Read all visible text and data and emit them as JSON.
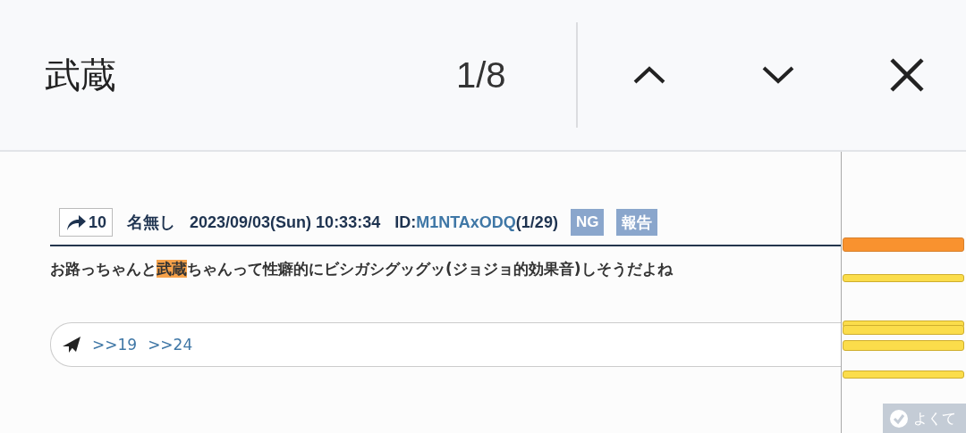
{
  "find_bar": {
    "query": "武蔵",
    "count": "1/8"
  },
  "post": {
    "share_count": "10",
    "name": "名無し",
    "date": "2023/09/03(Sun) 10:33:34",
    "id_label": "ID:",
    "id": "M1NTAxODQ",
    "id_count": "(1/29)",
    "buttons": [
      "NG",
      "報告"
    ],
    "body": [
      {
        "text": "お路っちゃんと",
        "highlighted": false
      },
      {
        "text": "武蔵",
        "highlighted": true
      },
      {
        "text": "ちゃんって性癖的にビシガシグッグッ(ジョジョ的効果音)しそうだよね",
        "highlighted": false
      }
    ],
    "replies": [
      ">>19",
      ">>24"
    ]
  },
  "scroll_markers": [
    {
      "selected": true
    },
    {
      "selected": false
    },
    {
      "selected": false
    },
    {
      "selected": false
    },
    {
      "selected": false
    },
    {
      "selected": false
    }
  ],
  "corner_button": {
    "label": "よくて"
  }
}
